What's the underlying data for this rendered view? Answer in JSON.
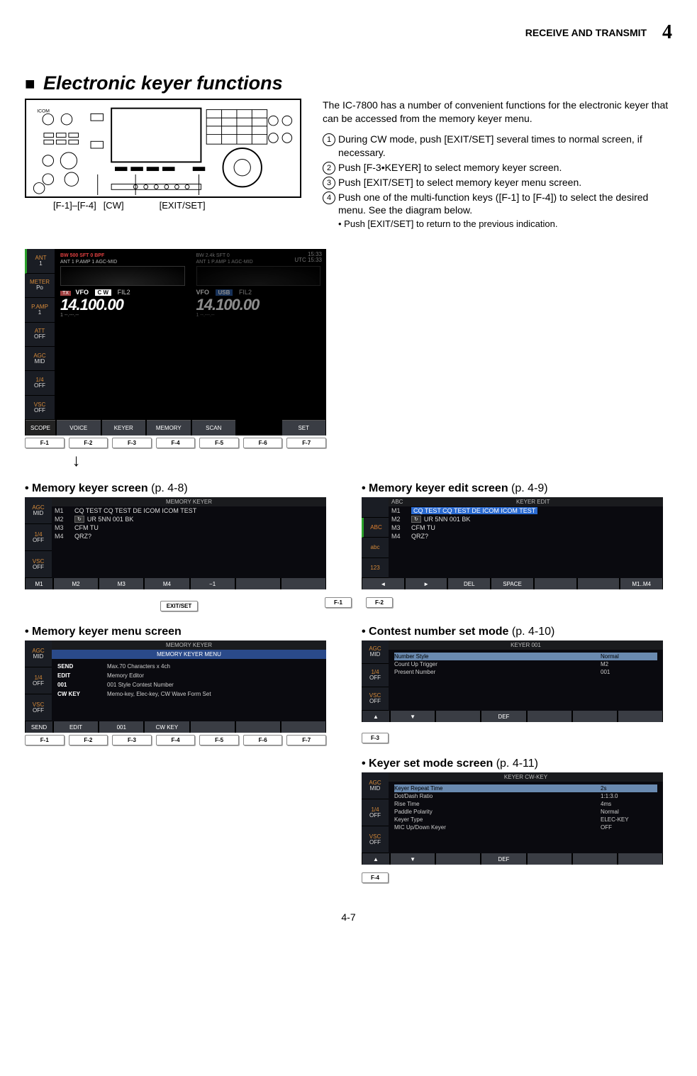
{
  "header": {
    "section": "RECEIVE AND TRANSMIT",
    "chapter": "4"
  },
  "title_prefix": "■",
  "title": "Electronic keyer functions",
  "radio_callouts": [
    "[F-1]–[F-4]",
    "[CW]",
    "[EXIT/SET]"
  ],
  "intro": "The IC-7800 has a number of convenient functions for the electronic keyer that can be accessed from the memory keyer menu.",
  "steps": [
    "During CW mode, push [EXIT/SET] several times to normal screen, if necessary.",
    "Push [F-3•KEYER] to select memory keyer screen.",
    "Push [EXIT/SET] to select memory keyer menu screen.",
    "Push one of the multi-function keys ([F-1] to [F-4]) to select the desired menu. See the diagram below."
  ],
  "step_sub": "• Push [EXIT/SET] to return to the previous indication.",
  "main_screen": {
    "side": [
      {
        "t": "ANT",
        "v": "1"
      },
      {
        "t": "METER",
        "v": "Po"
      },
      {
        "t": "P.AMP",
        "v": "1"
      },
      {
        "t": "ATT",
        "v": "OFF"
      },
      {
        "t": "AGC",
        "v": "MID"
      },
      {
        "t": "1/4",
        "v": "OFF"
      },
      {
        "t": "VSC",
        "v": "OFF"
      }
    ],
    "left": {
      "hdr": "BW 500  SFT   0        BPF",
      "sub": "ANT 1   P.AMP 1            AGC-MID",
      "tx": "TX",
      "vfo": "VFO",
      "mode": "C W",
      "fil": "FIL2",
      "freq": "14.100.00",
      "fsub": "1  --.---.--"
    },
    "right": {
      "hdr": "BW 2.4k  SFT   0",
      "sub": "ANT 1   P.AMP 1            AGC-MID",
      "vfo": "VFO",
      "mode": "USB",
      "fil": "FIL2",
      "freq": "14.100.00",
      "fsub": "1  --.---.--"
    },
    "clock": {
      "t": "15:33",
      "u": "UTC 15:33"
    },
    "tabs": [
      "SCOPE",
      "VOICE",
      "KEYER",
      "MEMORY",
      "SCAN",
      "",
      "SET"
    ],
    "tabs_firstlabel": "SCOPE",
    "fkeys": [
      "F-1",
      "F-2",
      "F-3",
      "F-4",
      "F-5",
      "F-6",
      "F-7"
    ]
  },
  "captions": {
    "mem_keyer": "• Memory keyer screen",
    "mem_keyer_p": "(p. 4-8)",
    "edit": "• Memory keyer edit screen",
    "edit_p": "(p. 4-9)",
    "menu": "• Memory keyer menu screen",
    "contest": "• Contest number set mode",
    "contest_p": "(p. 4-10)",
    "keyerset": "• Keyer set mode screen",
    "keyerset_p": "(p. 4-11)"
  },
  "mem_keyer_screen": {
    "side": [
      {
        "t": "AGC",
        "v": "MID"
      },
      {
        "t": "1/4",
        "v": "OFF"
      },
      {
        "t": "VSC",
        "v": "OFF"
      }
    ],
    "title": "MEMORY  KEYER",
    "rows": [
      {
        "ch": "M1",
        "rep": "",
        "txt": "CQ  TEST  CQ  TEST  DE  ICOM  ICOM  TEST"
      },
      {
        "ch": "M2",
        "rep": "↻",
        "txt": "UR  5NN 001  BK"
      },
      {
        "ch": "M3",
        "rep": "",
        "txt": "CFM  TU"
      },
      {
        "ch": "M4",
        "rep": "",
        "txt": "QRZ?"
      }
    ],
    "bottom": [
      "M1",
      "M2",
      "M3",
      "M4",
      "−1",
      "",
      ""
    ]
  },
  "edit_screen": {
    "side": [
      {
        "t": "",
        "v": ""
      },
      {
        "t": "ABC",
        "v": ""
      },
      {
        "t": "abc",
        "v": ""
      },
      {
        "t": "123",
        "v": ""
      }
    ],
    "title": "KEYER  EDIT",
    "title_left": "ABC",
    "rows": [
      {
        "ch": "M1",
        "rep": "",
        "txt": "CQ  TEST  CQ  TEST  DE  ICOM  ICOM  TEST",
        "hlt": true
      },
      {
        "ch": "M2",
        "rep": "↻",
        "txt": "UR  5NN 001  BK"
      },
      {
        "ch": "M3",
        "rep": "",
        "txt": "CFM  TU"
      },
      {
        "ch": "M4",
        "rep": "",
        "txt": "QRZ?"
      }
    ],
    "bottom": [
      "◄",
      "►",
      "DEL",
      "SPACE",
      "",
      "",
      "M1..M4"
    ]
  },
  "menu_screen": {
    "side": [
      {
        "t": "AGC",
        "v": "MID"
      },
      {
        "t": "1/4",
        "v": "OFF"
      },
      {
        "t": "VSC",
        "v": "OFF"
      }
    ],
    "title": "MEMORY  KEYER",
    "subtitle": "MEMORY  KEYER  MENU",
    "rows": [
      {
        "k": "SEND",
        "v": "Max.70  Characters  x  4ch"
      },
      {
        "k": "EDIT",
        "v": "Memory  Editor"
      },
      {
        "k": "001",
        "v": "001  Style  Contest  Number"
      },
      {
        "k": "CW  KEY",
        "v": "Memo-key,  Elec-key,  CW  Wave  Form  Set"
      }
    ],
    "bottom": [
      "SEND",
      "EDIT",
      "001",
      "CW  KEY",
      "",
      "",
      ""
    ],
    "fkeys": [
      "F-1",
      "F-2",
      "F-3",
      "F-4",
      "F-5",
      "F-6",
      "F-7"
    ]
  },
  "contest_screen": {
    "side": [
      {
        "t": "AGC",
        "v": "MID"
      },
      {
        "t": "1/4",
        "v": "OFF"
      },
      {
        "t": "VSC",
        "v": "OFF"
      }
    ],
    "title": "KEYER  001",
    "rows": [
      {
        "k": "Number  Style",
        "v": "Normal",
        "sel": true
      },
      {
        "k": "Count  Up  Trigger",
        "v": "M2"
      },
      {
        "k": "Present  Number",
        "v": "001"
      }
    ],
    "bottom": [
      "▲",
      "▼",
      "",
      "DEF",
      "",
      "",
      ""
    ]
  },
  "keyerset_screen": {
    "side": [
      {
        "t": "AGC",
        "v": "MID"
      },
      {
        "t": "1/4",
        "v": "OFF"
      },
      {
        "t": "VSC",
        "v": "OFF"
      }
    ],
    "title": "KEYER  CW-KEY",
    "rows": [
      {
        "k": "Keyer  Repeat  Time",
        "v": "2s",
        "sel": true
      },
      {
        "k": "Dot/Dash  Ratio",
        "v": "1:1:3.0"
      },
      {
        "k": "Rise  Time",
        "v": "4ms"
      },
      {
        "k": "Paddle  Polarity",
        "v": "Normal"
      },
      {
        "k": "Keyer  Type",
        "v": "ELEC-KEY"
      },
      {
        "k": "MIC  Up/Down  Keyer",
        "v": "OFF"
      }
    ],
    "bottom": [
      "▲",
      "▼",
      "",
      "DEF",
      "",
      "",
      ""
    ]
  },
  "chips": {
    "exitset": "EXIT/SET",
    "f1": "F-1",
    "f2": "F-2",
    "f3": "F-3",
    "f4": "F-4"
  },
  "page": "4-7"
}
